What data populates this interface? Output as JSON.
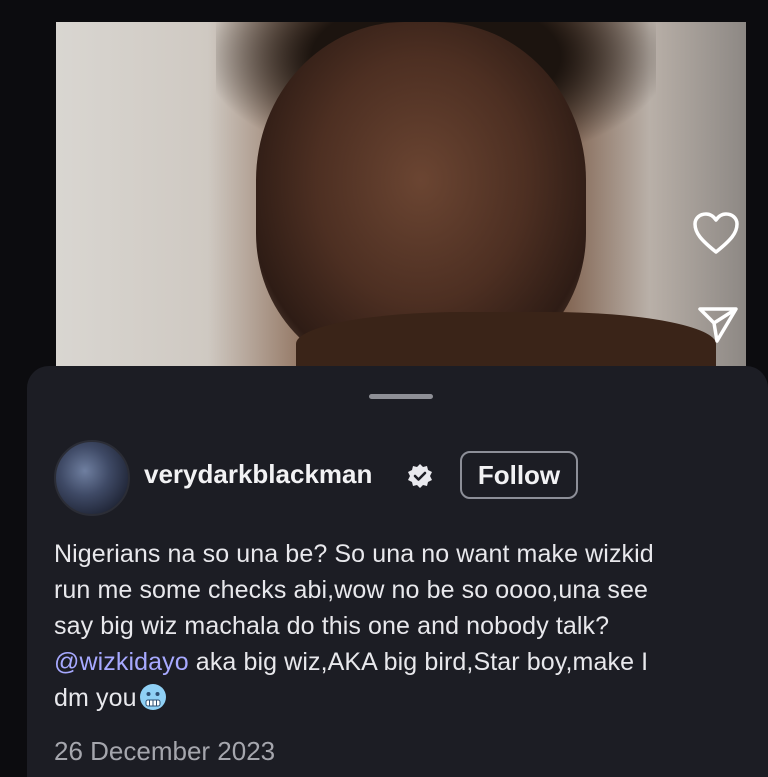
{
  "post": {
    "username": "verydarkblackman",
    "follow_label": "Follow",
    "caption_line1": "Nigerians na so una be? So una no want make wizkid",
    "caption_line2": "run me some checks abi,wow no be so oooo,una see",
    "caption_line3": "say big wiz machala do this one and nobody talk?",
    "mention": "@wizkidayo",
    "caption_line4_rest": " aka big wiz,AKA big bird,Star boy,make I",
    "caption_line5": "dm you",
    "date": "26 December 2023"
  },
  "icons": {
    "like": "heart-icon",
    "share": "send-icon",
    "verified": "verified-badge-icon",
    "emoji": "cold-face-emoji-icon"
  },
  "colors": {
    "sheet_bg": "#1c1d24",
    "mention": "#a7a9ff",
    "text": "#e8e8ec",
    "date": "#a5a6ad"
  }
}
